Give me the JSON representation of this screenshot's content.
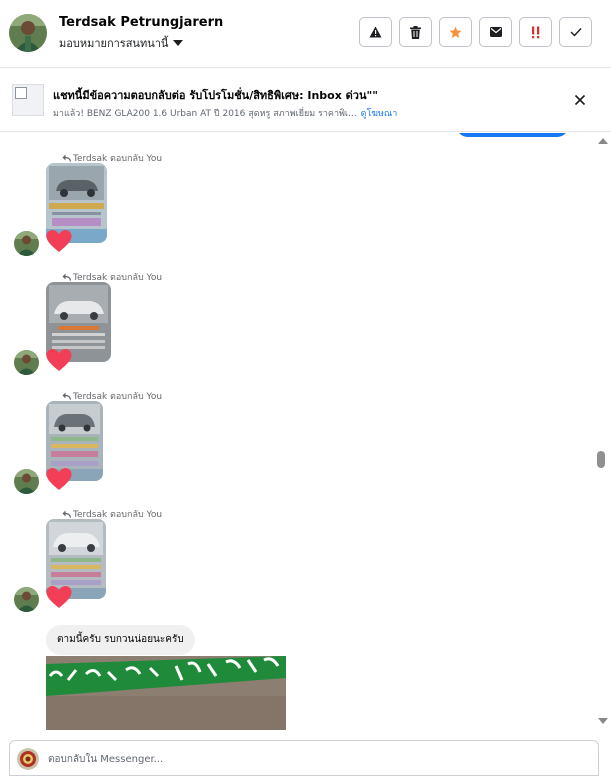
{
  "header": {
    "name": "Terdsak Petrungjarern",
    "assign_label": "มอบหมายการสนทนานี้",
    "actions": [
      "warning-icon",
      "trash-icon",
      "star-icon",
      "envelope-icon",
      "important-icon",
      "check-icon"
    ],
    "accent_star": "#f7923a",
    "accent_important": "#e02b2b"
  },
  "banner": {
    "title": "แชทนี้มีข้อความตอบกลับต่อ รับโปรโมชั่น/สิทธิพิเศษ: Inbox ด่วน\"\"",
    "subtitle": "มาแล้ว! BENZ GLA200 1.6 Urban AT ปี 2016 สุดหรู สภาพเยี่ยม ราคาพิเ...",
    "link": "ดูโฆษณา"
  },
  "messages": {
    "reply_label": "Terdsak ตอบกลับ You",
    "reaction": "heart-icon",
    "text_bubble": "ตามนี้ครับ รบกวนน่อยนะครับ",
    "accent_blue": "#1877f2",
    "heart_color": "#f33e58"
  },
  "composer": {
    "placeholder": "ตอบกลับใน Messenger..."
  }
}
